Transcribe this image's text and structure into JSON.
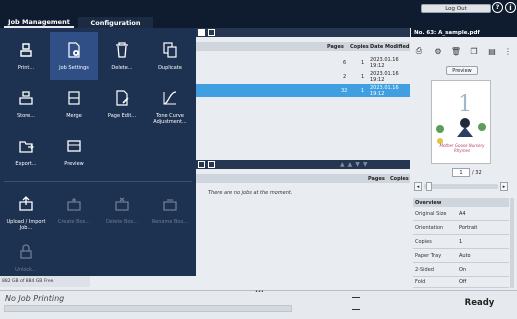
{
  "tabs": {
    "job_management": "Job Management",
    "configuration": "Configuration"
  },
  "top": {
    "logout": "Log Out"
  },
  "list": {
    "headers": {
      "pages": "Pages",
      "copies": "Copies",
      "date": "Date Modified"
    },
    "rows": [
      {
        "pages": "6",
        "copies": "1",
        "date": "2023.01.16 19:12"
      },
      {
        "pages": "2",
        "copies": "1",
        "date": "2023.01.16 19:12"
      },
      {
        "pages": "32",
        "copies": "1",
        "date": "2023.01.16 19:12"
      }
    ],
    "lower_headers": {
      "pages": "Pages",
      "copies": "Copies"
    },
    "empty": "There are no jobs at the moment."
  },
  "menu": {
    "items": [
      {
        "label": "Print...",
        "icon": "print-icon"
      },
      {
        "label": "Job Settings",
        "icon": "job-settings-icon"
      },
      {
        "label": "Delete...",
        "icon": "trash-icon"
      },
      {
        "label": "Duplicate",
        "icon": "duplicate-icon"
      },
      {
        "label": "Store...",
        "icon": "store-icon"
      },
      {
        "label": "Merge",
        "icon": "merge-icon"
      },
      {
        "label": "Page Edit...",
        "icon": "page-edit-icon"
      },
      {
        "label": "Tone Curve Adjustment...",
        "icon": "tone-curve-icon"
      },
      {
        "label": "Export...",
        "icon": "export-icon"
      },
      {
        "label": "Preview",
        "icon": "preview-icon"
      },
      {
        "label": "Upload / Import Job...",
        "icon": "upload-icon"
      },
      {
        "label": "Create Box...",
        "icon": "create-box-icon"
      },
      {
        "label": "Delete Box...",
        "icon": "delete-box-icon"
      },
      {
        "label": "Rename Box...",
        "icon": "rename-box-icon"
      },
      {
        "label": "Unlock...",
        "icon": "lock-icon"
      }
    ],
    "storage": "882 GB of 884 GB Free"
  },
  "panel": {
    "title": "No. 63: A_sample.pdf",
    "preview_button": "Preview",
    "thumb_text": "Mother Goose Nursery Rhymes",
    "page_value": "1",
    "page_total": "/ 32",
    "overview_title": "Overview",
    "overview": [
      {
        "k": "Original Size",
        "v": "A4"
      },
      {
        "k": "Orientation",
        "v": "Portrait"
      },
      {
        "k": "Copies",
        "v": "1"
      },
      {
        "k": "Paper Tray",
        "v": "Auto"
      },
      {
        "k": "2-Sided",
        "v": "On"
      },
      {
        "k": "Fold",
        "v": "Off"
      }
    ]
  },
  "status": {
    "printing": "No Job Printing",
    "ready": "Ready"
  }
}
